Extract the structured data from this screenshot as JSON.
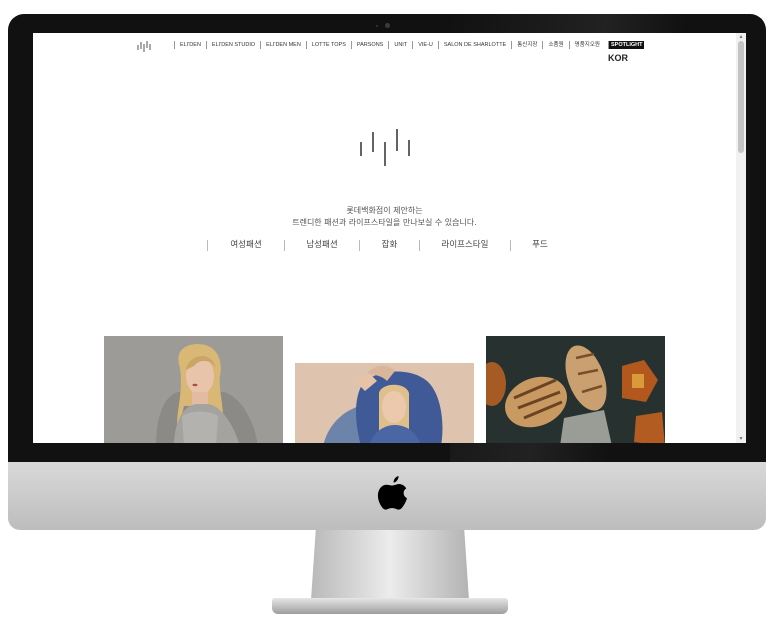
{
  "nav": {
    "items": [
      "ELI'DEN",
      "ELI'DEN STUDIO",
      "ELI'DEN MEN",
      "LOTTE TOPS",
      "PARSONS",
      "UNIT",
      "VIE-U",
      "SALON DE SHARLOTTE",
      "통신지장",
      "소품원",
      "명품지오원"
    ],
    "spotlight": "SPOTLIGHT",
    "language": "KOR"
  },
  "intro": {
    "line1": "롯데백화점이 제안하는",
    "line2": "트렌디한 패션과 라이프스타일을 만나보실 수 있습니다."
  },
  "categories": [
    "여성패션",
    "남성패션",
    "잡화",
    "라이프스타일",
    "푸드"
  ],
  "colors": {
    "bezel": "#111111",
    "chin": "#cfcfcf",
    "spotlight_bg": "#111111",
    "text": "#333333"
  }
}
